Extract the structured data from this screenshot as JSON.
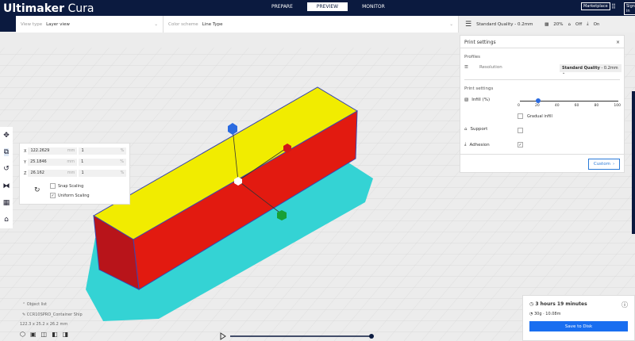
{
  "app": {
    "brand_bold": "Ultimaker",
    "brand_light": "Cura"
  },
  "stages": [
    "PREPARE",
    "PREVIEW",
    "MONITOR"
  ],
  "header": {
    "marketplace": "Marketplace",
    "sign_in": "Sign in"
  },
  "view_bar": {
    "view_type_label": "View type",
    "view_type_value": "Layer view",
    "color_scheme_label": "Color scheme",
    "color_scheme_value": "Line Type"
  },
  "quality_bar": {
    "profile": "Standard Quality - 0.2mm",
    "infill": "20%",
    "support": "Off",
    "adhesion": "On"
  },
  "print_settings": {
    "title": "Print settings",
    "profiles_label": "Profiles",
    "resolution_label": "Resolution",
    "resolution_value_bold": "Standard Quality",
    "resolution_value": "- 0.2mm",
    "section_label": "Print settings",
    "infill_label": "Infill (%)",
    "infill_value": 20,
    "infill_ticks": [
      "0",
      "20",
      "40",
      "60",
      "80",
      "100"
    ],
    "gradual_infill": "Gradual infill",
    "support_label": "Support",
    "support_checked": false,
    "adhesion_label": "Adhesion",
    "adhesion_checked": true,
    "custom_button": "Custom"
  },
  "scale_tool": {
    "x": "122.2629",
    "y": "25.1846",
    "z": "26.162",
    "unit": "mm",
    "x_pct": "1",
    "y_pct": "1",
    "z_pct": "1",
    "pct": "%",
    "snap_scaling": "Snap Scaling",
    "uniform_scaling": "Uniform Scaling",
    "axis_x": "X",
    "axis_y": "Y",
    "axis_z": "Z"
  },
  "object_info": {
    "list_label": "Object list",
    "name": "CCR10SPRO_Container Ship",
    "dims": "122.3 x 25.2 x 26.2 mm"
  },
  "job": {
    "time": "3 hours 19 minutes",
    "material": "30g · 10.08m",
    "save_button": "Save to Disk"
  },
  "colors": {
    "header": "#0b1a3f",
    "accent": "#196ef0",
    "top_infill": "#f4f000",
    "wall": "#e41b12",
    "brim": "#2fd6d6"
  }
}
